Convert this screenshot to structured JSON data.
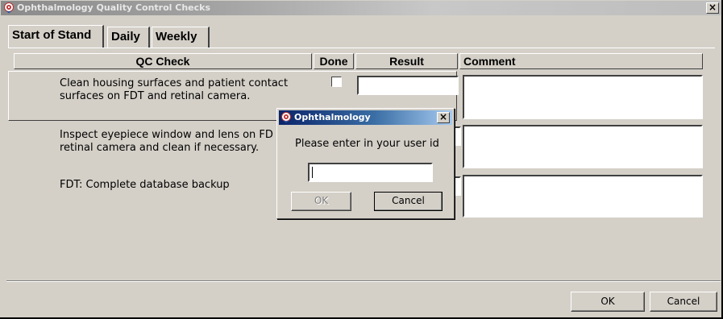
{
  "window": {
    "title": "Ophthalmology Quality Control Checks",
    "close_label": "×"
  },
  "tabs": [
    {
      "label": "Start of Stand",
      "active": true
    },
    {
      "label": "Daily",
      "active": false
    },
    {
      "label": "Weekly",
      "active": false
    }
  ],
  "table": {
    "headers": {
      "check": "QC Check",
      "done": "Done",
      "result": "Result",
      "comment": "Comment"
    },
    "rows": [
      {
        "task_line1": "Clean housing surfaces and patient contact",
        "task_line2": "surfaces on FDT and retinal camera.",
        "done": false,
        "result": "",
        "comment": ""
      },
      {
        "task_line1": "Inspect eyepiece window and lens on FD",
        "task_line2": "retinal camera and clean if necessary.",
        "done": false,
        "result": "",
        "comment": ""
      },
      {
        "task_line1": "FDT: Complete database backup",
        "task_line2": "",
        "done": false,
        "result": "",
        "comment": ""
      }
    ]
  },
  "footer": {
    "ok_label": "OK",
    "cancel_label": "Cancel"
  },
  "dialog": {
    "title": "Ophthalmology",
    "close_label": "×",
    "prompt": "Please enter in your user id",
    "input_value": "",
    "ok_label": "OK",
    "cancel_label": "Cancel"
  },
  "icons": {
    "app": "ophthalmology-app-icon"
  },
  "colors": {
    "face": "#d4d0c8",
    "active_title": "#0a246a",
    "inactive_title": "#8a8a8a"
  }
}
